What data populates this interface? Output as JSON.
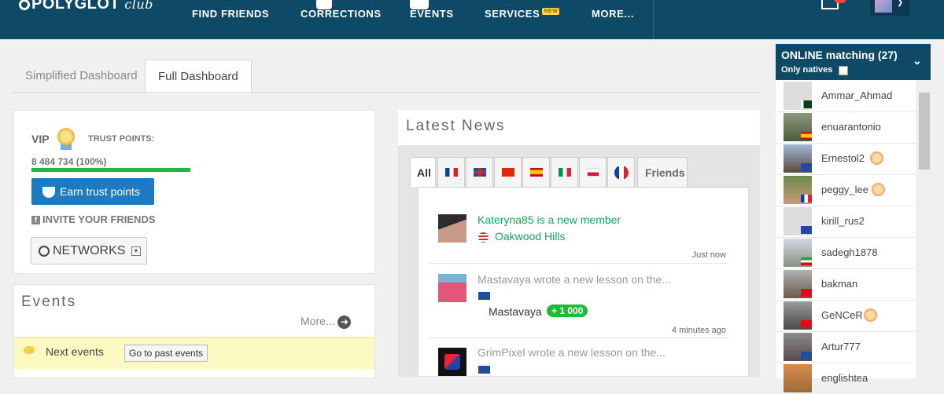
{
  "header": {
    "logo_main": "POLYGLOT",
    "logo_sub": "club",
    "nav": [
      "FIND FRIENDS",
      "CORRECTIONS",
      "EVENTS",
      "SERVICES",
      "MORE..."
    ],
    "new_badge": "NEW"
  },
  "dashboard_tabs": [
    "Simplified Dashboard",
    "Full Dashboard"
  ],
  "trust": {
    "vip": "VIP",
    "trust_label": "TRUST POINTS:",
    "trust_value": "8 484 734 (100%)",
    "progress": 1.0,
    "earn_button": "Earn trust points",
    "invite": "INVITE YOUR FRIENDS",
    "networks": "NETWORKS"
  },
  "events": {
    "title": "Events",
    "more": "More...",
    "next_events": "Next events",
    "past_button": "Go to past events"
  },
  "news": {
    "title": "Latest News",
    "tab_all": "All",
    "tab_friends": "Friends",
    "items": [
      {
        "title": "Kateryna85 is a new member",
        "location": "Oakwood Hills",
        "time": "Just now"
      },
      {
        "title": "Mastavaya wrote a new lesson on the...",
        "user": "Mastavaya",
        "points": "+ 1 000",
        "time": "4 minutes ago"
      },
      {
        "title": "GrimPixel wrote a new lesson on the..."
      }
    ]
  },
  "online": {
    "title": "ONLINE matching (27)",
    "only_natives": "Only natives",
    "users": [
      {
        "name": "Ammar_Ahmad"
      },
      {
        "name": "enuarantonio"
      },
      {
        "name": "Ernestol2"
      },
      {
        "name": "peggy_lee"
      },
      {
        "name": "kirill_rus2"
      },
      {
        "name": "sadegh1878"
      },
      {
        "name": "bakman"
      },
      {
        "name": "GeNCeR"
      },
      {
        "name": "Artur777"
      },
      {
        "name": "englishtea"
      }
    ]
  },
  "colors": {
    "header_bg": "#0e4a66",
    "accent_green": "#1fba3a",
    "button_blue": "#1f7bc1",
    "link_green": "#1ca25a"
  }
}
